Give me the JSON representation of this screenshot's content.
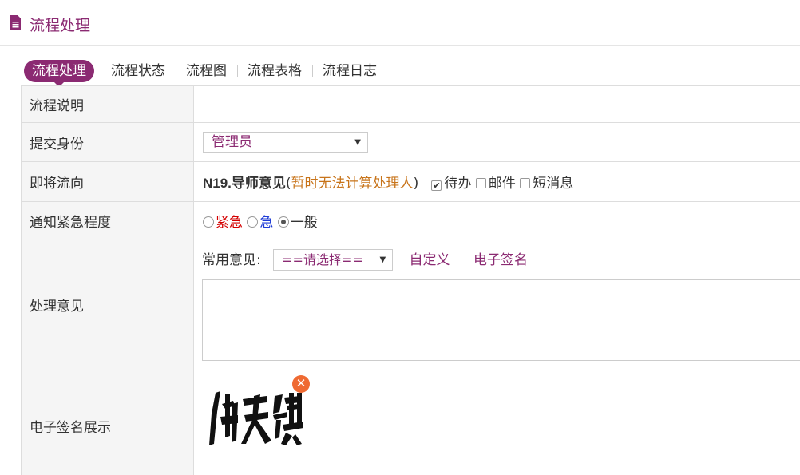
{
  "page": {
    "title": "流程处理"
  },
  "tabs": [
    {
      "label": "流程处理",
      "active": true
    },
    {
      "label": "流程状态"
    },
    {
      "label": "流程图"
    },
    {
      "label": "流程表格"
    },
    {
      "label": "流程日志"
    }
  ],
  "form": {
    "description": {
      "label": "流程说明",
      "value": ""
    },
    "identity": {
      "label": "提交身份",
      "selected": "管理员"
    },
    "next_step": {
      "label": "即将流向",
      "target": "N19.导师意见",
      "paren_open": "(",
      "note": "暂时无法计算处理人",
      "paren_close": ")",
      "checks": [
        {
          "label": "待办",
          "checked": true
        },
        {
          "label": "邮件",
          "checked": false
        },
        {
          "label": "短消息",
          "checked": false
        }
      ]
    },
    "urgency": {
      "label": "通知紧急程度",
      "options": [
        {
          "label": "紧急",
          "selected": false,
          "color": "#d40000"
        },
        {
          "label": "急",
          "selected": false,
          "color": "#1f3cd6"
        },
        {
          "label": "一般",
          "selected": true,
          "color": "#333333"
        }
      ]
    },
    "opinion": {
      "label": "处理意见",
      "common_label": "常用意见:",
      "common_selected": "==请选择==",
      "custom_link": "自定义",
      "signature_link": "电子签名",
      "text": ""
    },
    "signature": {
      "label": "电子签名展示",
      "delete_icon": "close-circle-icon",
      "image": "仲天琪"
    }
  },
  "colors": {
    "accent": "#8b2a72",
    "warn": "#c8741a",
    "delete": "#ef6a32"
  }
}
